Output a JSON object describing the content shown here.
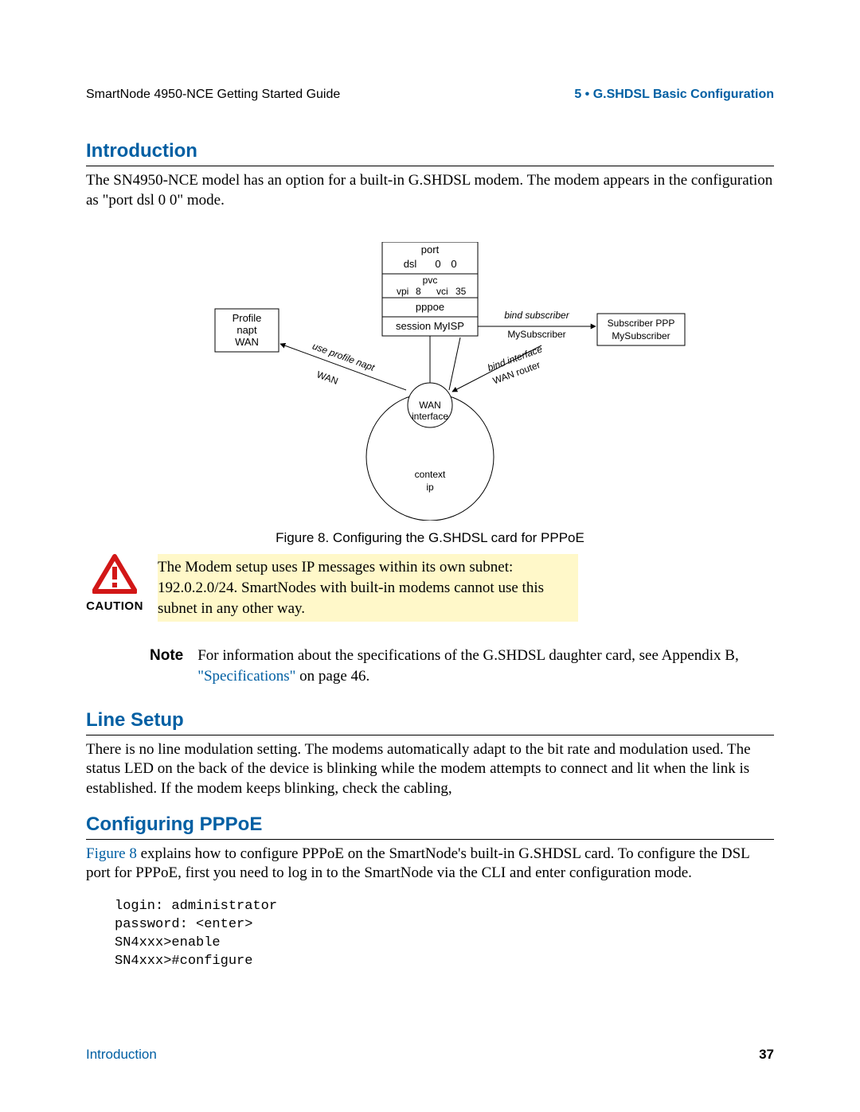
{
  "header": {
    "left": "SmartNode 4950-NCE Getting Started Guide",
    "right": "5 • G.SHDSL Basic Configuration"
  },
  "section_intro": {
    "title": "Introduction",
    "body": "The SN4950-NCE model has an option for a built-in G.SHDSL modem. The modem appears in the configuration as \"port dsl 0 0\" mode."
  },
  "figure": {
    "caption": "Figure 8. Configuring the G.SHDSL card for PPPoE",
    "labels": {
      "port": "port",
      "dsl": "dsl",
      "dsl_00a": "0",
      "dsl_00b": "0",
      "pvc": "pvc",
      "vpi": "vpi",
      "vpi_v": "8",
      "vci": "vci",
      "vci_v": "35",
      "pppoe": "pppoe",
      "session": "session MyISP",
      "profile_t": "Profile",
      "profile_m": "napt",
      "profile_b": "WAN",
      "sub_t": "Subscriber PPP",
      "sub_b": "MySubscriber",
      "bind_sub_t": "bind subscriber",
      "bind_sub_b": "MySubscriber",
      "use_prof_t": "use profile napt",
      "use_prof_b": "WAN",
      "bind_if_t": "bind interface",
      "bind_if_b": "WAN router",
      "wan_t": "WAN",
      "wan_b": "interface",
      "ctx_t": "context",
      "ctx_b": "ip"
    }
  },
  "caution": {
    "label": "CAUTION",
    "text": "The Modem setup uses IP messages within its own subnet: 192.0.2.0/24. SmartNodes with built-in modems cannot use this subnet in any other way."
  },
  "note": {
    "label": "Note",
    "pre": "For information about the specifications of the G.SHDSL daughter card, see Appendix B, ",
    "link": "\"Specifications\"",
    "post": " on page 46."
  },
  "section_line": {
    "title": "Line Setup",
    "body": "There is no line modulation setting. The modems automatically adapt to the bit rate and modulation used. The status LED on the back of the device is blinking while the modem attempts to connect and lit when the link is established. If the modem keeps blinking, check the cabling,"
  },
  "section_pppoe": {
    "title": "Configuring PPPoE",
    "link": "Figure 8",
    "post": " explains how to configure PPPoE on the SmartNode's built-in G.SHDSL card. To configure the DSL port for PPPoE, first you need to log in to the SmartNode via the CLI and enter configuration mode."
  },
  "code": "login: administrator\npassword: <enter>\nSN4xxx>enable\nSN4xxx>#configure",
  "footer": {
    "left": "Introduction",
    "right": "37"
  }
}
